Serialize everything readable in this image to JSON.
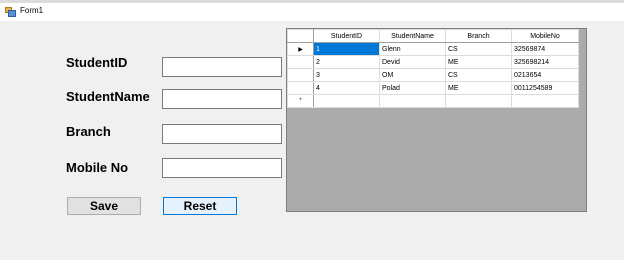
{
  "window": {
    "title": "Form1",
    "icon": "form-window-icon"
  },
  "form": {
    "labels": {
      "student_id": "StudentID",
      "student_name": "StudentName",
      "branch": "Branch",
      "mobile": "Mobile No"
    },
    "fields": {
      "student_id": "",
      "student_name": "",
      "branch": "",
      "mobile": ""
    },
    "buttons": {
      "save": "Save",
      "reset": "Reset"
    }
  },
  "grid": {
    "columns": [
      "StudentID",
      "StudentName",
      "Branch",
      "MobileNo"
    ],
    "rows": [
      {
        "id": "1",
        "name": "Glenn",
        "branch": "CS",
        "mobile": "32569874"
      },
      {
        "id": "2",
        "name": "Devid",
        "branch": "ME",
        "mobile": "325698214"
      },
      {
        "id": "3",
        "name": "OM",
        "branch": "CS",
        "mobile": "0213654"
      },
      {
        "id": "4",
        "name": "Polad",
        "branch": "ME",
        "mobile": "0011254589"
      }
    ],
    "current_row_marker": "▶",
    "new_row_marker": "*",
    "colors": {
      "selection": "#0078d7",
      "background": "#ababab"
    }
  }
}
